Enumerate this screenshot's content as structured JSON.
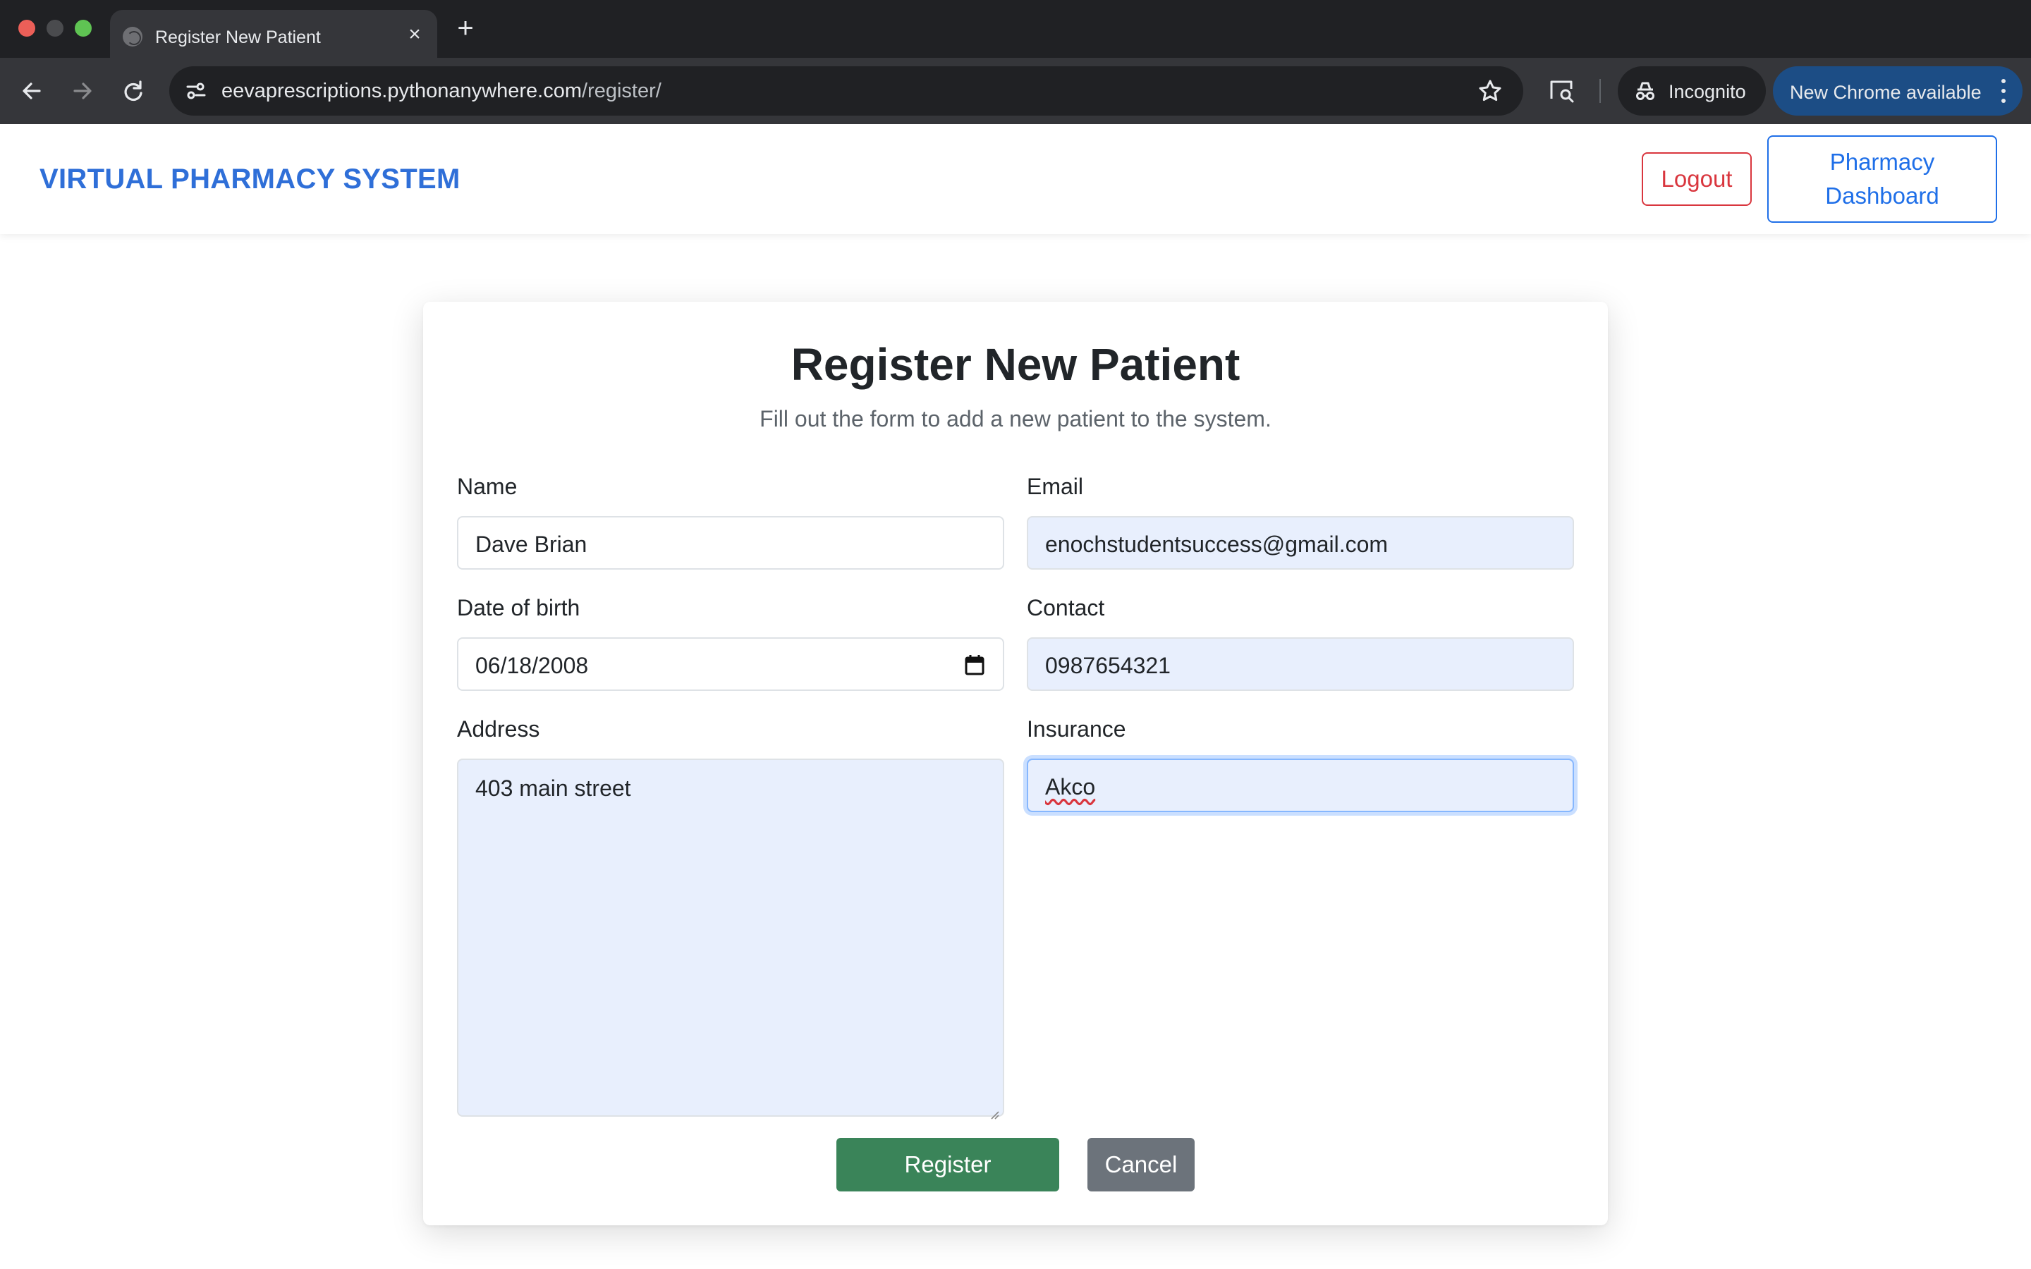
{
  "browser": {
    "tab_title": "Register New Patient",
    "tab_close": "×",
    "new_tab": "+",
    "url_host": "eevaprescriptions.pythonanywhere.com",
    "url_path": "/register/",
    "incognito_label": "Incognito",
    "update_label": "New Chrome available",
    "icons": [
      "back-icon",
      "forward-icon",
      "reload-icon",
      "site-info-icon",
      "star-icon",
      "cast-icon",
      "incognito-icon",
      "more-icon"
    ]
  },
  "navbar": {
    "brand": "VIRTUAL PHARMACY SYSTEM",
    "logout_label": "Logout",
    "dashboard_label_line1": "Pharmacy",
    "dashboard_label_line2": "Dashboard"
  },
  "form": {
    "title": "Register New Patient",
    "subtitle": "Fill out the form to add a new patient to the system.",
    "fields": {
      "name": {
        "label": "Name",
        "value": "Dave Brian"
      },
      "email": {
        "label": "Email",
        "value": "enochstudentsuccess@gmail.com"
      },
      "dob": {
        "label": "Date of birth",
        "value": "06/18/2008"
      },
      "contact": {
        "label": "Contact",
        "value": "0987654321"
      },
      "address": {
        "label": "Address",
        "value": "403 main street"
      },
      "insurance": {
        "label": "Insurance",
        "value": "Akco"
      }
    },
    "register_label": "Register",
    "cancel_label": "Cancel"
  },
  "colors": {
    "brand": "#2f6fd8",
    "logout": "#d9363e",
    "register": "#3a8459",
    "cancel": "#6c737b",
    "autofill": "#e8effd"
  }
}
